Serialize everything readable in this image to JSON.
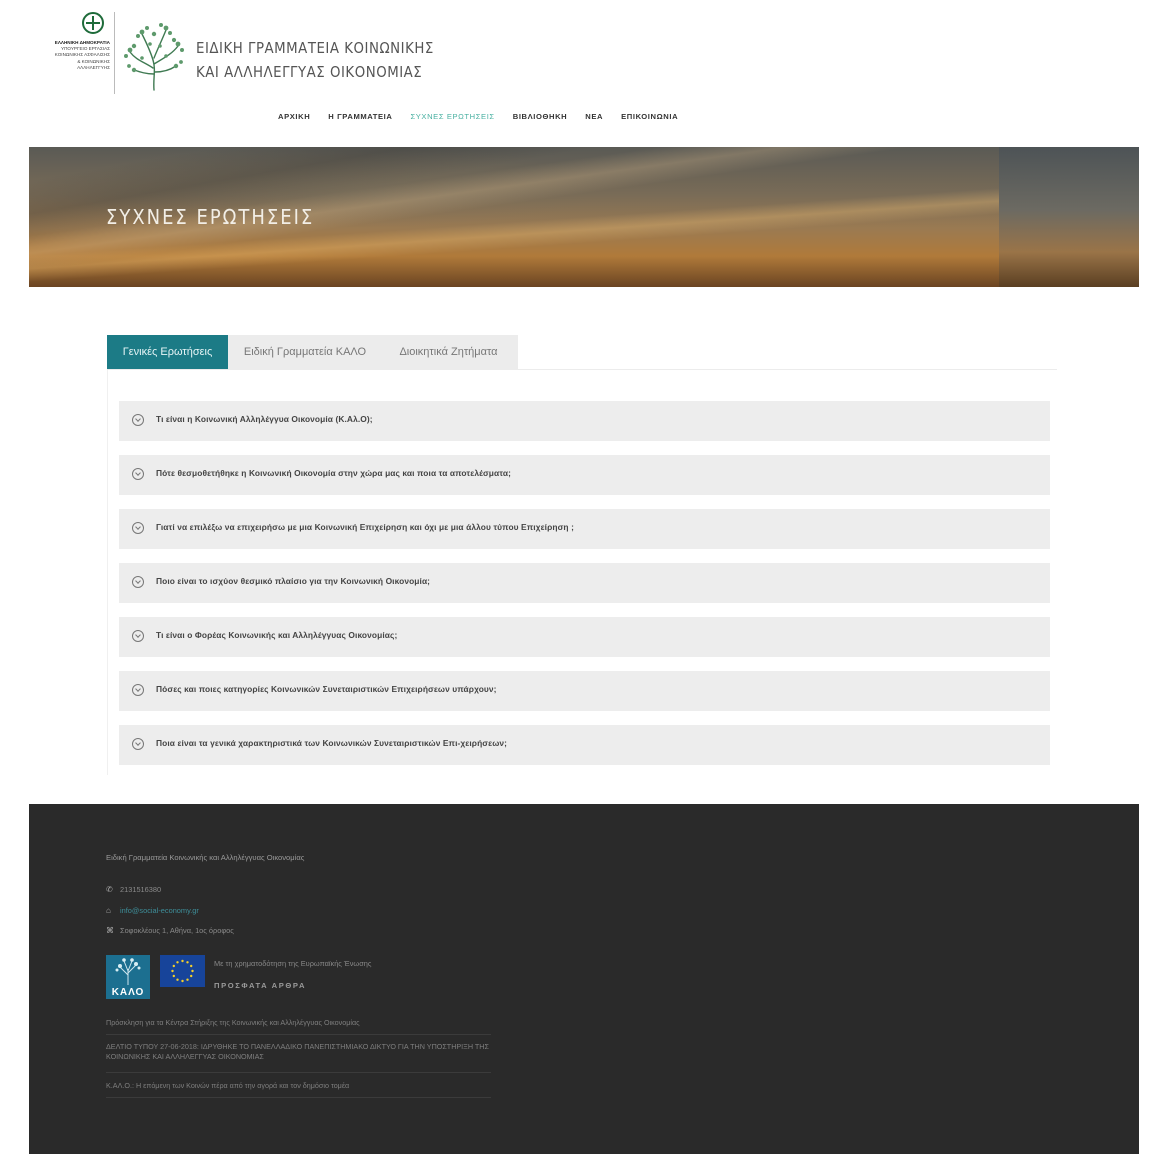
{
  "header": {
    "gov_logo": {
      "ministry_lines": [
        "ΕΛΛΗΝΙΚΗ ΔΗΜΟΚΡΑΤΙΑ",
        "ΥΠΟΥΡΓΕΙΟ ΕΡΓΑΣΙΑΣ",
        "ΚΟΙΝΩΝΙΚΗΣ ΑΣΦΑΛΙΣΗΣ",
        "& ΚΟΙΝΩΝΙΚΗΣ",
        "ΑΛΛΗΛΕΓΓΥΗΣ"
      ]
    },
    "site_title_line1": "ΕΙΔΙΚΗ ΓΡΑΜΜΑΤΕΙΑ ΚΟΙΝΩΝΙΚΗΣ",
    "site_title_line2": "ΚΑΙ ΑΛΛΗΛΕΓΓΥΑΣ ΟΙΚΟΝΟΜΙΑΣ",
    "nav": [
      {
        "label": "ΑΡΧΙΚΗ",
        "active": false
      },
      {
        "label": "Η ΓΡΑΜΜΑΤΕΙΑ",
        "active": false
      },
      {
        "label": "ΣΥΧΝΕΣ ΕΡΩΤΗΣΕΙΣ",
        "active": true
      },
      {
        "label": "ΒΙΒΛΙΟΘΗΚΗ",
        "active": false
      },
      {
        "label": "ΝΕΑ",
        "active": false
      },
      {
        "label": "ΕΠΙΚΟΙΝΩΝΙΑ",
        "active": false
      }
    ],
    "active_color": "#48b0a1"
  },
  "banner": {
    "title": "ΣΥΧΝΕΣ ΕΡΩΤΗΣΕΙΣ"
  },
  "tabs": [
    {
      "label": "Γενικές Ερωτήσεις",
      "active": true
    },
    {
      "label": "Ειδική Γραμματεία ΚΑΛΟ",
      "active": false
    },
    {
      "label": "Διοικητικά Ζητήματα",
      "active": false
    }
  ],
  "tab_active_color": "#1c7b86",
  "faq": [
    "Τι είναι η Κοινωνική Αλληλέγγυα Οικονομία (Κ.Αλ.Ο);",
    "Πότε θεσμοθετήθηκε η Κοινωνική Οικονομία στην χώρα μας και ποια τα αποτελέσματα;",
    "Γιατί να επιλέξω να επιχειρήσω με μια Κοινωνική Επιχείρηση και όχι με μια άλλου τύπου Επιχείρηση ;",
    "Ποιο είναι το ισχύον θεσμικό πλαίσιο για την Κοινωνική Οικονομία;",
    "Τι είναι ο Φορέας Κοινωνικής και Αλληλέγγυας Οικονομίας;",
    "Πόσες και ποιες κατηγορίες Κοινωνικών Συνεταιριστικών Επιχειρήσεων υπάρχουν;",
    "Ποια είναι τα γενικά χαρακτηριστικά των Κοινωνικών Συνεταιριστικών Επι-χειρήσεων;"
  ],
  "faq_icon": "chevron-down-circle-icon",
  "footer": {
    "org_name": "Ειδική Γραμματεία Κοινωνικής και Αλληλέγγυας Οικονομίας",
    "phone": "2131516380",
    "email": "info@social-economy.gr",
    "address": "Σοφοκλέους 1, Αθήνα, 1ος όροφος",
    "kalo_label": "ΚΑΛΟ",
    "eu_support": "Με τη χρηματοδότηση της Ευρωπαϊκής Ένωσης",
    "recent_title": "ΠΡΟΣΦΑΤΑ ΑΡΘΡΑ",
    "articles": [
      "Πρόσκληση για τα Κέντρα Στήριξης της Κοινωνικής και Αλληλέγγυας Οικονομίας",
      "ΔΕΛΤΙΟ ΤΥΠΟΥ 27-06-2018: ΙΔΡΥΘΗΚΕ ΤΟ ΠΑΝΕΛΛΑΔΙΚΟ ΠΑΝΕΠΙΣΤΗΜΙΑΚΟ ΔΙΚΤΥΟ ΓΙΑ ΤΗΝ ΥΠΟΣΤΗΡΙΞΗ ΤΗΣ ΚΟΙΝΩΝΙΚΗΣ ΚΑΙ ΑΛΛΗΛΕΓΓΥΑΣ ΟΙΚΟΝΟΜΙΑΣ",
      "Κ.ΑΛ.Ο.: Η επόμενη των Κοινών πέρα από την αγορά και τον δημόσιο τομέα"
    ]
  }
}
